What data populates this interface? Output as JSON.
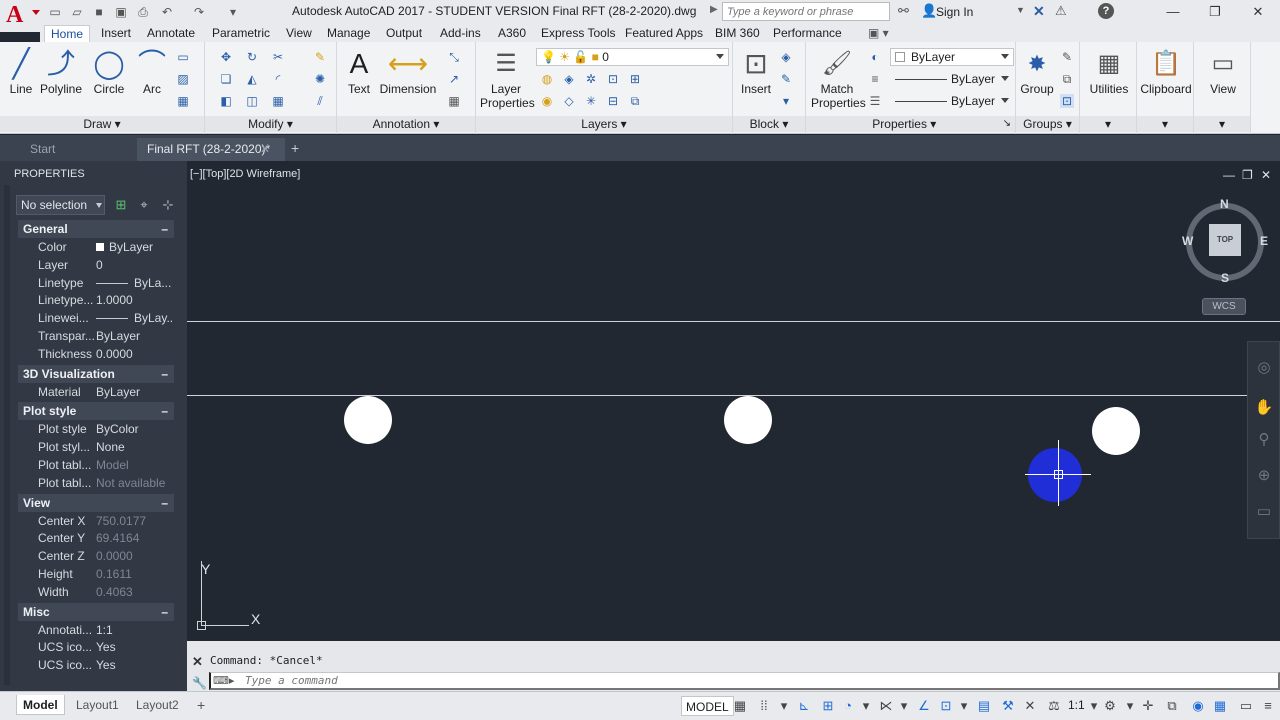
{
  "titlebar": {
    "title": "Autodesk AutoCAD 2017 - STUDENT VERSION    Final RFT (28-2-2020).dwg",
    "search_placeholder": "Type a keyword or phrase",
    "sign_in": "Sign In",
    "app_logo_letter": "A"
  },
  "ribbon_tabs": [
    "Home",
    "Insert",
    "Annotate",
    "Parametric",
    "View",
    "Manage",
    "Output",
    "Add-ins",
    "A360",
    "Express Tools",
    "Featured Apps",
    "BIM 360",
    "Performance"
  ],
  "ribbon": {
    "draw": {
      "title": "Draw",
      "tools": [
        "Line",
        "Polyline",
        "Circle",
        "Arc"
      ]
    },
    "modify": {
      "title": "Modify"
    },
    "annotation": {
      "title": "Annotation",
      "tools": [
        "Text",
        "Dimension"
      ]
    },
    "layers": {
      "title": "Layers",
      "layer_properties": "Layer Properties",
      "current_layer": "0"
    },
    "block": {
      "title": "Block",
      "insert": "Insert"
    },
    "properties": {
      "title": "Properties",
      "match_properties": "Match Properties",
      "color": "ByLayer",
      "linetype": "ByLayer",
      "lineweight": "ByLayer"
    },
    "groups": {
      "title": "Groups",
      "group": "Group"
    },
    "utilities": "Utilities",
    "clipboard": "Clipboard",
    "view": "View"
  },
  "doc_tabs": {
    "start": "Start",
    "active": "Final RFT (28-2-2020)*"
  },
  "properties_palette": {
    "title": "PROPERTIES",
    "selection": "No selection",
    "sections": [
      {
        "name": "General",
        "rows": [
          {
            "label": "Color",
            "value": "ByLayer"
          },
          {
            "label": "Layer",
            "value": "0"
          },
          {
            "label": "Linetype",
            "value": "ByLa..."
          },
          {
            "label": "Linetype...",
            "value": "1.0000"
          },
          {
            "label": "Linewei...",
            "value": "ByLay..."
          },
          {
            "label": "Transpar...",
            "value": "ByLayer"
          },
          {
            "label": "Thickness",
            "value": "0.0000"
          }
        ]
      },
      {
        "name": "3D Visualization",
        "rows": [
          {
            "label": "Material",
            "value": "ByLayer"
          }
        ]
      },
      {
        "name": "Plot style",
        "rows": [
          {
            "label": "Plot style",
            "value": "ByColor"
          },
          {
            "label": "Plot styl...",
            "value": "None"
          },
          {
            "label": "Plot tabl...",
            "value": "Model"
          },
          {
            "label": "Plot tabl...",
            "value": "Not available"
          }
        ]
      },
      {
        "name": "View",
        "rows": [
          {
            "label": "Center X",
            "value": "750.0177"
          },
          {
            "label": "Center Y",
            "value": "69.4164"
          },
          {
            "label": "Center Z",
            "value": "0.0000"
          },
          {
            "label": "Height",
            "value": "0.1611"
          },
          {
            "label": "Width",
            "value": "0.4063"
          }
        ]
      },
      {
        "name": "Misc",
        "rows": [
          {
            "label": "Annotati...",
            "value": "1:1"
          },
          {
            "label": "UCS ico...",
            "value": "Yes"
          },
          {
            "label": "UCS ico...",
            "value": "Yes"
          }
        ]
      }
    ]
  },
  "viewport": {
    "label": "[−][Top][2D Wireframe]",
    "viewcube": {
      "n": "N",
      "s": "S",
      "e": "E",
      "w": "W",
      "top": "TOP"
    },
    "wcs": "WCS",
    "ucs_x": "X",
    "ucs_y": "Y",
    "selected_color": "#1f2ed6"
  },
  "command": {
    "history": "Command: *Cancel*",
    "placeholder": "Type a command"
  },
  "statusbar": {
    "layouts": [
      "Model",
      "Layout1",
      "Layout2"
    ],
    "model_button": "MODEL",
    "scale": "1:1"
  }
}
